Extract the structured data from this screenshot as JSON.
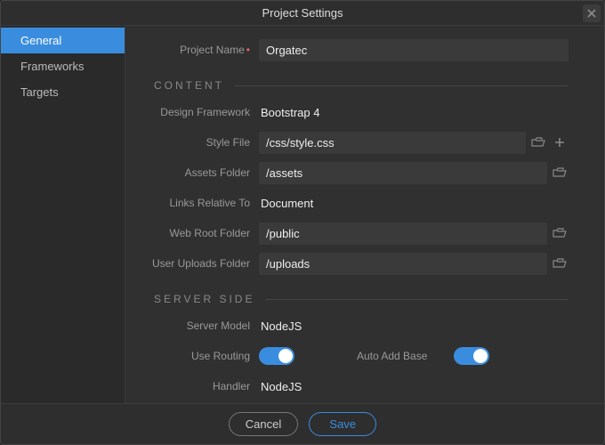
{
  "title": "Project Settings",
  "sidebar": {
    "items": [
      {
        "label": "General",
        "active": true
      },
      {
        "label": "Frameworks"
      },
      {
        "label": "Targets"
      }
    ]
  },
  "project_name": {
    "label": "Project Name",
    "value": "Orgatec"
  },
  "sections": {
    "content": {
      "header": "CONTENT",
      "design_framework": {
        "label": "Design Framework",
        "value": "Bootstrap 4"
      },
      "style_file": {
        "label": "Style File",
        "value": "/css/style.css"
      },
      "assets_folder": {
        "label": "Assets Folder",
        "value": "/assets"
      },
      "links_relative_to": {
        "label": "Links Relative To",
        "value": "Document"
      },
      "web_root_folder": {
        "label": "Web Root Folder",
        "value": "/public"
      },
      "user_uploads": {
        "label": "User Uploads Folder",
        "value": "/uploads"
      }
    },
    "server": {
      "header": "SERVER SIDE",
      "server_model": {
        "label": "Server Model",
        "value": "NodeJS"
      },
      "use_routing": {
        "label": "Use Routing",
        "value": true
      },
      "auto_add_base": {
        "label": "Auto Add Base",
        "value": true
      },
      "handler": {
        "label": "Handler",
        "value": "NodeJS"
      }
    }
  },
  "footer": {
    "cancel": "Cancel",
    "save": "Save"
  },
  "colors": {
    "accent": "#3a8dde"
  }
}
